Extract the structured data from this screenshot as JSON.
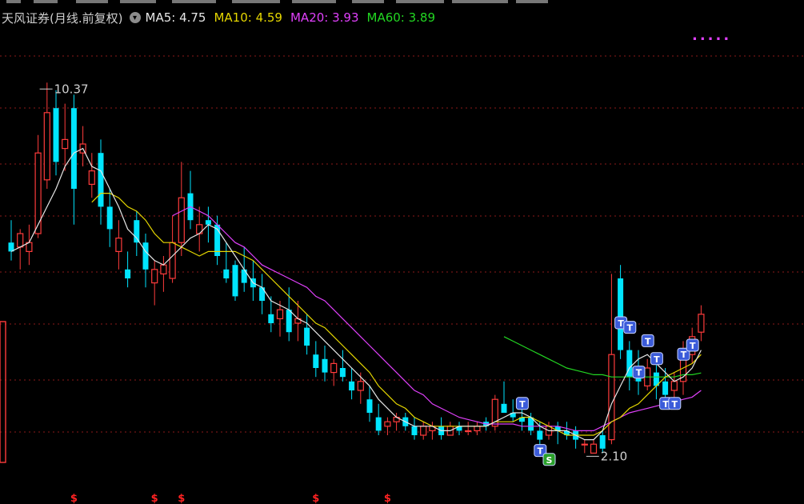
{
  "legend": {
    "title": "天风证券",
    "period": "(月线.前复权)",
    "items": [
      {
        "label": "MA5: 4.75",
        "color": "#e6e6e6"
      },
      {
        "label": "MA10: 4.59",
        "color": "#e5d600"
      },
      {
        "label": "MA20: 3.93",
        "color": "#e040fb"
      },
      {
        "label": "MA60: 3.89",
        "color": "#22d622"
      }
    ],
    "more": "....."
  },
  "colors": {
    "up": "#ff3b3b",
    "down": "#00e5ff",
    "ma5": "#e6e6e6",
    "ma10": "#e5d600",
    "ma20": "#e040fb",
    "ma60": "#22d622",
    "grid": "#8b1a1a",
    "marker_s": "#ff2222",
    "signal_t": "#3b5bd9",
    "signal_s": "#2aa12a"
  },
  "chart_data": {
    "type": "candlestick",
    "ylim": [
      1.5,
      11.5
    ],
    "max_annotation": {
      "label": "10.37",
      "value": 10.37,
      "index": 3
    },
    "min_annotation": {
      "label": "2.10",
      "value": 2.1,
      "index": 64
    },
    "candles": [
      [
        6.8,
        7.3,
        6.4,
        6.6
      ],
      [
        6.7,
        7.1,
        6.2,
        7.0
      ],
      [
        6.6,
        7.2,
        6.3,
        6.8
      ],
      [
        7.0,
        9.2,
        6.9,
        8.8
      ],
      [
        8.2,
        10.37,
        8.0,
        9.7
      ],
      [
        9.8,
        10.2,
        8.3,
        8.6
      ],
      [
        8.9,
        9.9,
        8.4,
        9.1
      ],
      [
        9.8,
        10.1,
        7.2,
        8.0
      ],
      [
        8.8,
        9.4,
        8.5,
        9.0
      ],
      [
        8.1,
        8.8,
        7.8,
        8.4
      ],
      [
        8.8,
        9.1,
        7.2,
        7.6
      ],
      [
        7.6,
        8.0,
        6.7,
        7.1
      ],
      [
        6.6,
        7.3,
        6.2,
        6.9
      ],
      [
        6.2,
        6.6,
        5.8,
        6.0
      ],
      [
        7.3,
        7.5,
        6.5,
        6.8
      ],
      [
        6.8,
        7.0,
        5.8,
        6.2
      ],
      [
        5.9,
        6.4,
        5.4,
        6.2
      ],
      [
        6.1,
        6.5,
        5.7,
        6.3
      ],
      [
        6.0,
        7.4,
        5.9,
        6.8
      ],
      [
        6.8,
        8.6,
        6.5,
        7.8
      ],
      [
        7.9,
        8.4,
        7.1,
        7.3
      ],
      [
        7.0,
        7.6,
        6.6,
        7.2
      ],
      [
        7.3,
        7.6,
        6.8,
        7.2
      ],
      [
        7.2,
        7.4,
        6.3,
        6.5
      ],
      [
        6.2,
        6.8,
        5.9,
        6.0
      ],
      [
        6.3,
        6.4,
        5.5,
        5.6
      ],
      [
        6.2,
        6.7,
        5.7,
        5.9
      ],
      [
        6.0,
        6.4,
        5.5,
        5.8
      ],
      [
        5.8,
        6.1,
        5.2,
        5.5
      ],
      [
        5.2,
        5.6,
        4.8,
        5.0
      ],
      [
        5.1,
        5.5,
        4.7,
        5.3
      ],
      [
        5.3,
        5.8,
        4.6,
        4.8
      ],
      [
        5.0,
        5.5,
        4.6,
        5.1
      ],
      [
        4.9,
        5.2,
        4.3,
        4.5
      ],
      [
        4.3,
        4.6,
        3.8,
        4.0
      ],
      [
        4.2,
        4.5,
        3.7,
        3.9
      ],
      [
        3.9,
        4.2,
        3.6,
        4.1
      ],
      [
        4.0,
        4.4,
        3.7,
        3.8
      ],
      [
        3.7,
        4.0,
        3.3,
        3.5
      ],
      [
        3.5,
        3.9,
        3.2,
        3.7
      ],
      [
        3.3,
        3.6,
        2.8,
        3.0
      ],
      [
        2.9,
        3.2,
        2.5,
        2.6
      ],
      [
        2.7,
        2.9,
        2.5,
        2.8
      ],
      [
        2.8,
        3.0,
        2.6,
        2.9
      ],
      [
        2.9,
        3.0,
        2.6,
        2.7
      ],
      [
        2.7,
        2.9,
        2.4,
        2.5
      ],
      [
        2.5,
        2.8,
        2.4,
        2.7
      ],
      [
        2.6,
        2.8,
        2.4,
        2.7
      ],
      [
        2.7,
        2.9,
        2.4,
        2.5
      ],
      [
        2.5,
        2.8,
        2.5,
        2.7
      ],
      [
        2.7,
        2.8,
        2.5,
        2.6
      ],
      [
        2.6,
        2.8,
        2.5,
        2.6
      ],
      [
        2.6,
        2.8,
        2.5,
        2.7
      ],
      [
        2.8,
        2.9,
        2.6,
        2.7
      ],
      [
        2.7,
        3.4,
        2.6,
        3.3
      ],
      [
        3.2,
        3.7,
        3.0,
        3.0
      ],
      [
        3.0,
        3.3,
        2.8,
        2.9
      ],
      [
        2.9,
        3.2,
        2.6,
        2.8
      ],
      [
        2.9,
        3.0,
        2.5,
        2.6
      ],
      [
        2.6,
        2.8,
        2.2,
        2.4
      ],
      [
        2.5,
        2.8,
        2.4,
        2.7
      ],
      [
        2.7,
        2.8,
        2.3,
        2.6
      ],
      [
        2.6,
        2.8,
        2.4,
        2.5
      ],
      [
        2.6,
        2.7,
        2.2,
        2.4
      ],
      [
        2.3,
        2.4,
        2.1,
        2.3
      ],
      [
        2.1,
        2.4,
        2.1,
        2.3
      ],
      [
        2.5,
        2.6,
        2.1,
        2.2
      ],
      [
        2.4,
        6.1,
        2.3,
        4.3
      ],
      [
        6.0,
        6.3,
        4.2,
        4.4
      ],
      [
        4.4,
        4.6,
        3.5,
        3.8
      ],
      [
        3.8,
        4.4,
        3.4,
        3.7
      ],
      [
        3.6,
        4.2,
        3.5,
        4.0
      ],
      [
        3.9,
        4.2,
        3.3,
        3.6
      ],
      [
        3.7,
        4.0,
        3.2,
        3.4
      ],
      [
        3.5,
        3.9,
        3.3,
        3.7
      ],
      [
        3.7,
        4.6,
        3.4,
        4.4
      ],
      [
        4.3,
        4.9,
        4.1,
        4.7
      ],
      [
        4.8,
        5.4,
        4.6,
        5.2
      ]
    ],
    "ma5": [
      6.6,
      6.7,
      6.8,
      7.2,
      7.6,
      8.0,
      8.5,
      8.8,
      8.9,
      8.5,
      8.4,
      8.0,
      7.6,
      7.1,
      6.9,
      6.6,
      6.4,
      6.3,
      6.5,
      6.7,
      6.9,
      7.0,
      7.2,
      7.1,
      6.8,
      6.5,
      6.2,
      5.9,
      5.8,
      5.5,
      5.4,
      5.3,
      5.1,
      5.0,
      4.8,
      4.6,
      4.4,
      4.2,
      4.0,
      3.8,
      3.6,
      3.3,
      3.1,
      2.9,
      2.8,
      2.7,
      2.7,
      2.7,
      2.6,
      2.6,
      2.7,
      2.7,
      2.7,
      2.7,
      2.8,
      2.9,
      3.0,
      3.0,
      2.9,
      2.7,
      2.6,
      2.6,
      2.6,
      2.5,
      2.4,
      2.4,
      2.6,
      3.2,
      3.6,
      4.0,
      4.2,
      4.3,
      4.1,
      3.9,
      3.7,
      3.8,
      4.0,
      4.4
    ],
    "ma10": [
      null,
      null,
      null,
      null,
      null,
      null,
      null,
      null,
      null,
      7.7,
      7.9,
      7.9,
      7.8,
      7.6,
      7.5,
      7.3,
      7.0,
      6.8,
      6.8,
      6.7,
      6.6,
      6.5,
      6.6,
      6.6,
      6.6,
      6.6,
      6.5,
      6.4,
      6.2,
      6.0,
      5.8,
      5.6,
      5.4,
      5.2,
      5.0,
      4.9,
      4.7,
      4.5,
      4.3,
      4.1,
      3.9,
      3.6,
      3.4,
      3.2,
      3.1,
      2.9,
      2.8,
      2.7,
      2.7,
      2.7,
      2.7,
      2.7,
      2.7,
      2.7,
      2.8,
      2.8,
      2.8,
      2.9,
      2.9,
      2.8,
      2.7,
      2.6,
      2.5,
      2.5,
      2.5,
      2.5,
      2.6,
      2.8,
      2.9,
      3.1,
      3.2,
      3.4,
      3.6,
      3.8,
      3.9,
      4.0,
      4.1,
      4.3
    ],
    "ma20": [
      null,
      null,
      null,
      null,
      null,
      null,
      null,
      null,
      null,
      null,
      null,
      null,
      null,
      null,
      null,
      null,
      null,
      null,
      7.4,
      7.5,
      7.6,
      7.5,
      7.4,
      7.2,
      7.0,
      6.8,
      6.7,
      6.5,
      6.3,
      6.2,
      6.1,
      6.0,
      5.9,
      5.8,
      5.6,
      5.5,
      5.3,
      5.1,
      4.9,
      4.7,
      4.5,
      4.3,
      4.1,
      3.9,
      3.7,
      3.5,
      3.4,
      3.2,
      3.1,
      3.0,
      2.9,
      2.85,
      2.8,
      2.75,
      2.75,
      2.75,
      2.75,
      2.7,
      2.7,
      2.7,
      2.7,
      2.7,
      2.65,
      2.6,
      2.6,
      2.6,
      2.7,
      2.8,
      2.9,
      3.0,
      3.05,
      3.1,
      3.15,
      3.2,
      3.25,
      3.3,
      3.35,
      3.5
    ],
    "ma60": [
      null,
      null,
      null,
      null,
      null,
      null,
      null,
      null,
      null,
      null,
      null,
      null,
      null,
      null,
      null,
      null,
      null,
      null,
      null,
      null,
      null,
      null,
      null,
      null,
      null,
      null,
      null,
      null,
      null,
      null,
      null,
      null,
      null,
      null,
      null,
      null,
      null,
      null,
      null,
      null,
      null,
      null,
      null,
      null,
      null,
      null,
      null,
      null,
      null,
      null,
      null,
      null,
      null,
      null,
      null,
      4.7,
      4.6,
      4.5,
      4.4,
      4.3,
      4.2,
      4.1,
      4.0,
      3.95,
      3.9,
      3.85,
      3.85,
      3.8,
      3.8,
      3.8,
      3.8,
      3.8,
      3.8,
      3.8,
      3.8,
      3.85,
      3.85,
      3.89
    ],
    "signals": [
      {
        "index": 57,
        "label": "T",
        "value": 3.2
      },
      {
        "index": 59,
        "label": "T",
        "value": 2.15
      },
      {
        "index": 60,
        "label": "S",
        "value": 1.95
      },
      {
        "index": 68,
        "label": "T",
        "value": 5.0
      },
      {
        "index": 69,
        "label": "T",
        "value": 4.9
      },
      {
        "index": 70,
        "label": "T",
        "value": 3.9
      },
      {
        "index": 71,
        "label": "T",
        "value": 4.6
      },
      {
        "index": 72,
        "label": "T",
        "value": 4.2
      },
      {
        "index": 73,
        "label": "T",
        "value": 3.2
      },
      {
        "index": 74,
        "label": "T",
        "value": 3.2
      },
      {
        "index": 75,
        "label": "T",
        "value": 4.3
      },
      {
        "index": 76,
        "label": "T",
        "value": 4.5
      }
    ],
    "bottom_markers": [
      {
        "index": 7,
        "label": "$"
      },
      {
        "index": 16,
        "label": "$"
      },
      {
        "index": 19,
        "label": "$"
      },
      {
        "index": 34,
        "label": "$"
      },
      {
        "index": 42,
        "label": "$"
      }
    ]
  }
}
